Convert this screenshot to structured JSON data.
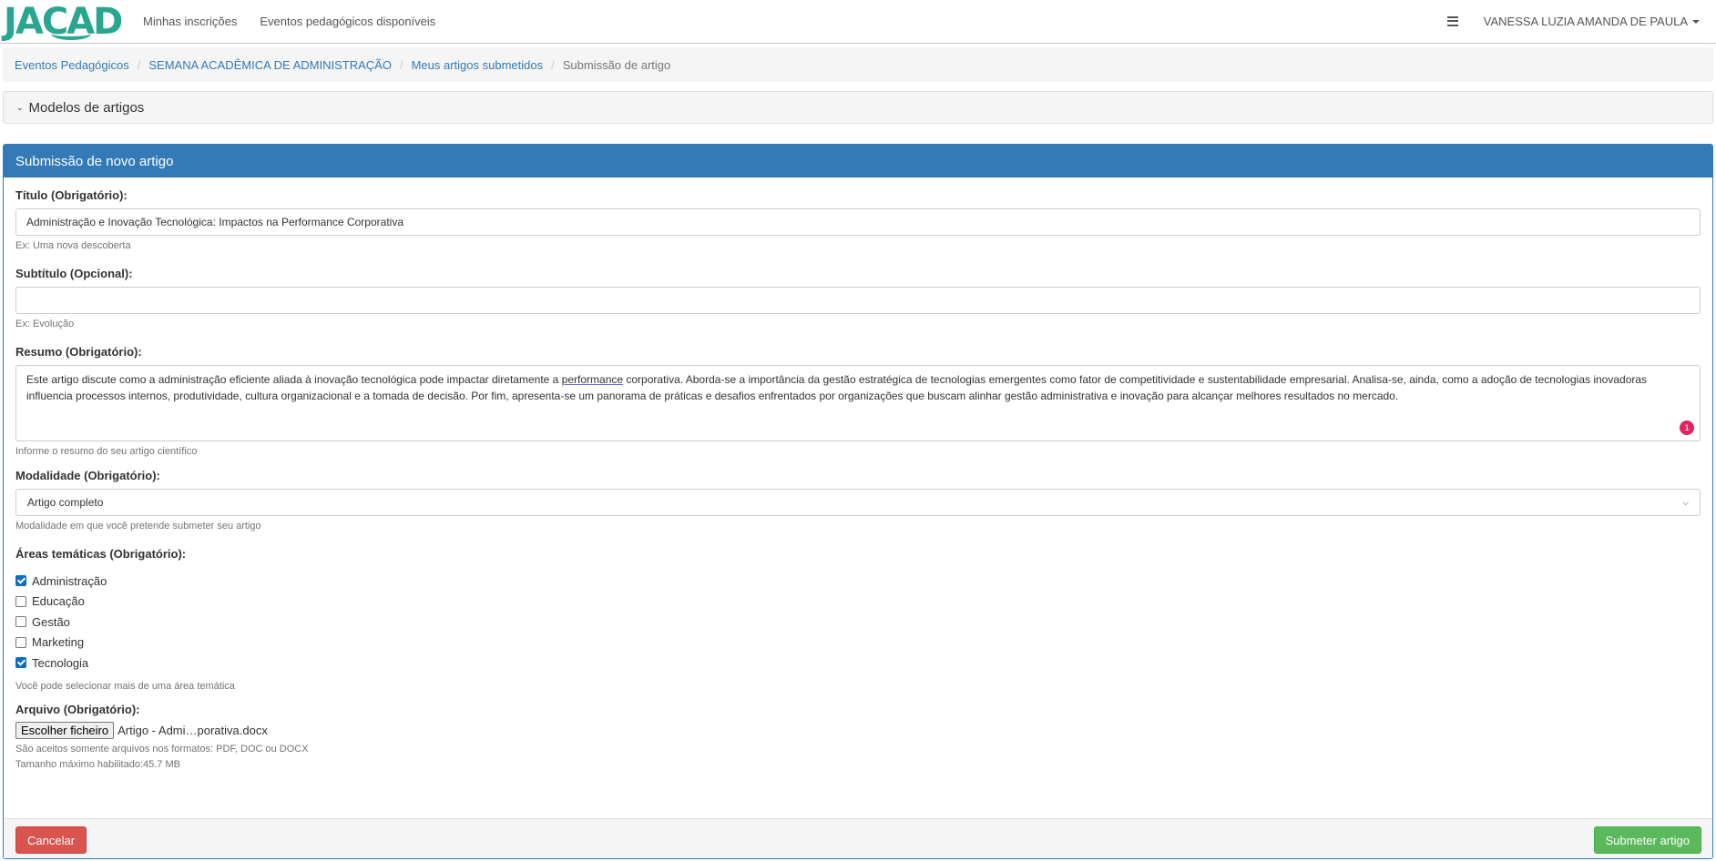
{
  "brand": {
    "logo_text": "JACAD",
    "color": "#2aa58f"
  },
  "nav": {
    "links": [
      "Minhas inscrições",
      "Eventos pedagógicos disponíveis"
    ],
    "menu_icon": "list-icon",
    "user_name": "VANESSA LUZIA AMANDA DE PAULA"
  },
  "breadcrumb": {
    "items": [
      "Eventos Pedagógicos",
      "SEMANA ACADÊMICA DE ADMINISTRAÇÃO",
      "Meus artigos submetidos"
    ],
    "current": "Submissão de artigo"
  },
  "models_panel": {
    "title": "Modelos de artigos"
  },
  "form": {
    "heading": "Submissão de novo artigo",
    "title": {
      "label": "Título (Obrigatório):",
      "value": "Administração e Inovação Tecnológica: Impactos na Performance Corporativa",
      "help": "Ex: Uma nova descoberta"
    },
    "subtitle": {
      "label": "Subtítulo (Opcional):",
      "value": "",
      "help": "Ex: Evolução"
    },
    "summary": {
      "label": "Resumo (Obrigatório):",
      "value_before": "Este artigo discute como a administração eficiente aliada à inovação tecnológica pode impactar diretamente a ",
      "value_marked": "performance",
      "value_after": " corporativa. Aborda-se a importância da gestão estratégica de tecnologias emergentes como fator de competitividade e sustentabilidade empresarial. Analisa-se, ainda, como a adoção de tecnologias inovadoras influencia processos internos, produtividade, cultura organizacional e a tomada de decisão. Por fim, apresenta-se um panorama de práticas e desafios enfrentados por organizações que buscam alinhar gestão administrativa e inovação para alcançar melhores resultados no mercado.",
      "badge": "1",
      "help": "Informe o resumo do seu artigo científico"
    },
    "modality": {
      "label": "Modalidade (Obrigatório):",
      "selected": "Artigo completo",
      "help": "Modalidade em que você pretende submeter seu artigo"
    },
    "areas": {
      "label": "Áreas temáticas (Obrigatório):",
      "options": [
        {
          "label": "Administração",
          "checked": true
        },
        {
          "label": "Educação",
          "checked": false
        },
        {
          "label": "Gestão",
          "checked": false
        },
        {
          "label": "Marketing",
          "checked": false
        },
        {
          "label": "Tecnologia",
          "checked": true
        }
      ],
      "help": "Você pode selecionar mais de uma área temática"
    },
    "file": {
      "label": "Arquivo (Obrigatório):",
      "button": "Escolher ficheiro",
      "filename": "Artigo - Admi…porativa.docx",
      "help_formats": "São aceitos somente arquivos nos formatos: PDF, DOC ou DOCX",
      "help_size": "Tamanho máximo habilitado:45.7 MB"
    }
  },
  "actions": {
    "cancel": "Cancelar",
    "submit": "Submeter artigo"
  },
  "colors": {
    "primary": "#337ab7",
    "danger": "#d9534f",
    "success": "#5cb85c"
  }
}
